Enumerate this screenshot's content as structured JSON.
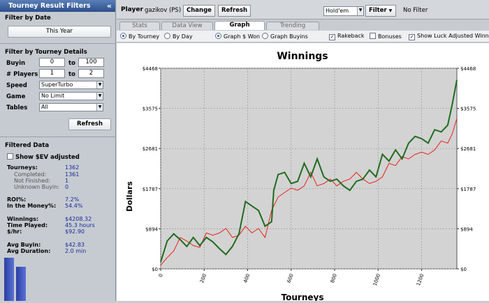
{
  "left": {
    "title": "Tourney Result Filters",
    "collapse": "«",
    "by_date_header": "Filter by Date",
    "date_button": "This Year",
    "details_header": "Filter by Tourney Details",
    "buyin_label": "Buyin",
    "buyin_from": "0",
    "buyin_to_label": "to",
    "buyin_to": "100",
    "players_label": "# Players",
    "players_from": "1",
    "players_to_label": "to",
    "players_to": "2",
    "speed_label": "Speed",
    "speed_value": "SuperTurbo",
    "game_label": "Game",
    "game_value": "No Limit",
    "tables_label": "Tables",
    "tables_value": "All",
    "refresh": "Refresh",
    "filtered_header": "Filtered Data",
    "sev_label": "Show $EV adjusted",
    "stats": [
      {
        "label": "Tourneys:",
        "value": "1362",
        "sub": false
      },
      {
        "label": "Completed:",
        "value": "1361",
        "sub": true
      },
      {
        "label": "Not Finished:",
        "value": "1",
        "sub": true
      },
      {
        "label": "Unknown Buyin:",
        "value": "0",
        "sub": true
      },
      {
        "label": "ROI%:",
        "value": "7.2%",
        "sub": false
      },
      {
        "label": "In the Money%:",
        "value": "54.4%",
        "sub": false
      },
      {
        "label": "Winnings:",
        "value": "$4208.32",
        "sub": false
      },
      {
        "label": "Time Played:",
        "value": "45.3 hours",
        "sub": false
      },
      {
        "label": "$/hr:",
        "value": "$92.90",
        "sub": false
      },
      {
        "label": "Avg Buyin:",
        "value": "$42.83",
        "sub": false
      },
      {
        "label": "Avg Duration:",
        "value": "2.0 min",
        "sub": false
      }
    ]
  },
  "top": {
    "player_label": "Player",
    "player_value": "gazikov (PS)",
    "change": "Change",
    "refresh": "Refresh",
    "game_select": "Hold'em",
    "filter": "Filter",
    "filter_status": "No Filter"
  },
  "tabs": [
    "Stats",
    "Data View",
    "Graph",
    "Trending"
  ],
  "options": {
    "by_tourney": "By Tourney",
    "by_day": "By Day",
    "graph_won": "Graph $ Won",
    "graph_buyins": "Graph Buyins",
    "rakeback": "Rakeback",
    "bonuses": "Bonuses",
    "luck": "Show Luck Adjusted Winnings"
  },
  "colors": {
    "winnings": "#1f6b1f",
    "luck": "#e8201a",
    "plot_bg": "#d3d3d3"
  },
  "chart_data": {
    "type": "line",
    "title": "Winnings",
    "xlabel": "Tourneys",
    "ylabel": "Dollars",
    "xlim": [
      0,
      1362
    ],
    "ylim": [
      0,
      4468
    ],
    "x_ticks": [
      "0",
      "200",
      "400",
      "600",
      "800",
      "1000",
      "1200"
    ],
    "y_ticks": [
      "$0",
      "$894",
      "$1787",
      "$2681",
      "$3575",
      "$4468"
    ],
    "grid": true,
    "series": [
      {
        "color": "#1f6b1f",
        "x": [
          0,
          30,
          60,
          90,
          120,
          150,
          180,
          210,
          240,
          270,
          300,
          330,
          360,
          390,
          420,
          450,
          480,
          510,
          520,
          540,
          570,
          600,
          630,
          660,
          690,
          720,
          750,
          780,
          810,
          840,
          870,
          900,
          930,
          960,
          990,
          1020,
          1050,
          1080,
          1110,
          1140,
          1170,
          1200,
          1230,
          1260,
          1290,
          1320,
          1340,
          1362
        ],
        "y": [
          150,
          620,
          780,
          650,
          500,
          700,
          520,
          700,
          600,
          450,
          320,
          500,
          780,
          1500,
          1400,
          1300,
          950,
          1050,
          1750,
          2100,
          2150,
          1900,
          1950,
          2350,
          2050,
          2450,
          2050,
          1950,
          2000,
          1850,
          1750,
          1950,
          2000,
          2200,
          2050,
          2550,
          2400,
          2650,
          2450,
          2800,
          2950,
          2900,
          2800,
          3100,
          3050,
          3200,
          3650,
          4208
        ]
      },
      {
        "color": "#e8201a",
        "x": [
          0,
          30,
          60,
          90,
          120,
          150,
          180,
          210,
          240,
          270,
          300,
          330,
          360,
          390,
          420,
          450,
          480,
          510,
          540,
          570,
          600,
          630,
          660,
          690,
          720,
          750,
          780,
          810,
          840,
          870,
          900,
          930,
          960,
          990,
          1020,
          1050,
          1080,
          1110,
          1140,
          1170,
          1200,
          1230,
          1260,
          1290,
          1320,
          1340,
          1362
        ],
        "y": [
          80,
          250,
          400,
          700,
          620,
          520,
          480,
          800,
          750,
          800,
          900,
          700,
          750,
          950,
          800,
          900,
          700,
          1300,
          1600,
          1700,
          1800,
          1750,
          1850,
          2150,
          1850,
          1900,
          2000,
          1850,
          1950,
          2000,
          2150,
          2000,
          1900,
          1950,
          2050,
          2350,
          2300,
          2500,
          2450,
          2550,
          2600,
          2550,
          2650,
          2850,
          2800,
          3000,
          3350
        ]
      }
    ]
  }
}
